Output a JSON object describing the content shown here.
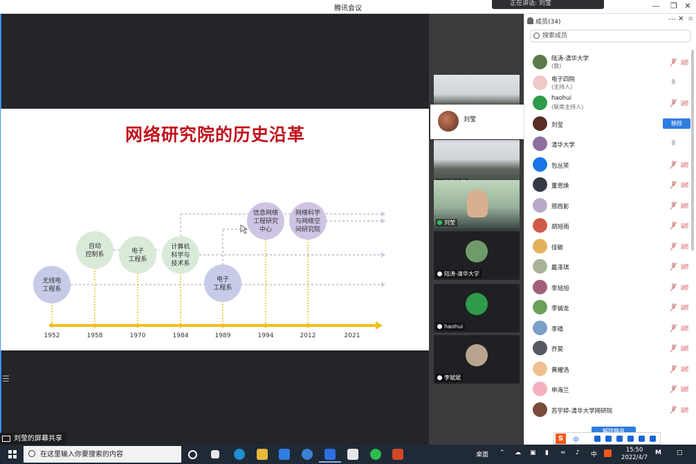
{
  "window": {
    "title": "腾讯会议",
    "speaking": "正在讲话: 刘莹"
  },
  "slide": {
    "title": "网络研究院的历史沿革",
    "nodes": [
      {
        "label": "无线电\n工程系",
        "color": "#c7cbe8"
      },
      {
        "label": "自动\n控制系",
        "color": "#d9ead8"
      },
      {
        "label": "电子\n工程系",
        "color": "#d9ead8"
      },
      {
        "label": "计算机\n科学与\n技术系",
        "color": "#d9ead8"
      },
      {
        "label": "电子\n工程系",
        "color": "#c7cbe8"
      },
      {
        "label": "信息网络\n工程研究\n中心",
        "color": "#cfc4e4"
      },
      {
        "label": "网络科学\n与网络空\n间研究院",
        "color": "#cfc4e4"
      }
    ],
    "years": [
      "1952",
      "1958",
      "1970",
      "1984",
      "1989",
      "1994",
      "2012",
      "2021"
    ],
    "accent": "#f0c020"
  },
  "share_label": "刘莹的屏幕共享",
  "videos": [
    {
      "name": "",
      "kind": "room"
    },
    {
      "name": "清华大学",
      "kind": "room"
    },
    {
      "name": "刘莹",
      "kind": "face"
    },
    {
      "name": "陆涛-清华大学",
      "kind": "avatar",
      "color": "#6f9a6a"
    },
    {
      "name": "haohui",
      "kind": "avatar",
      "color": "#2e9a4a"
    },
    {
      "name": "李斌斌",
      "kind": "avatar",
      "color": "#b9a58f"
    }
  ],
  "popup": {
    "name": "刘莹"
  },
  "panel": {
    "title": "成员(34)",
    "search_placeholder": "搜索成员",
    "members": [
      {
        "name": "陆涛-清华大学",
        "sub": "(我)",
        "color": "#5a7a4a"
      },
      {
        "name": "电子四院",
        "sub": "(主持人)",
        "color": "#f2c7c7",
        "mic_on": true
      },
      {
        "name": "haohui",
        "sub": "(联席主持人)",
        "color": "#2e9a4a"
      },
      {
        "name": "刘莹",
        "sub": "",
        "color": "#5a2d22",
        "button": "移除"
      },
      {
        "name": "清华大学",
        "sub": "",
        "color": "#8a6fa0",
        "mic_on": true
      },
      {
        "name": "包丛笑",
        "sub": "",
        "color": "#1a73e8"
      },
      {
        "name": "董思焕",
        "sub": "",
        "color": "#333a44"
      },
      {
        "name": "邢西影",
        "sub": "",
        "color": "#b7a9c7"
      },
      {
        "name": "胡旭雨",
        "sub": "",
        "color": "#d05a4a"
      },
      {
        "name": "佳敏",
        "sub": "",
        "color": "#e3b15a"
      },
      {
        "name": "戴泽琪",
        "sub": "",
        "color": "#a8b39a"
      },
      {
        "name": "李旭旭",
        "sub": "",
        "color": "#a0607a"
      },
      {
        "name": "李铖龙",
        "sub": "",
        "color": "#6aa05a"
      },
      {
        "name": "李晴",
        "sub": "",
        "color": "#7aa0c8"
      },
      {
        "name": "乔莫",
        "sub": "",
        "color": "#555a60"
      },
      {
        "name": "黄耀浩",
        "sub": "",
        "color": "#f0c090"
      },
      {
        "name": "申海兰",
        "sub": "",
        "color": "#f4b0c0"
      },
      {
        "name": "苏宇婷-清华大学网研院",
        "sub": "",
        "color": "#7a4a3a"
      }
    ],
    "release_button": "解除静音"
  },
  "ime": {
    "logo": "S",
    "mode": "中"
  },
  "taskbar": {
    "search_placeholder": "在这里输入你要搜索的内容",
    "desktop": "桌面",
    "ime": "中",
    "time": "15:50",
    "date": "2022/4/7"
  }
}
